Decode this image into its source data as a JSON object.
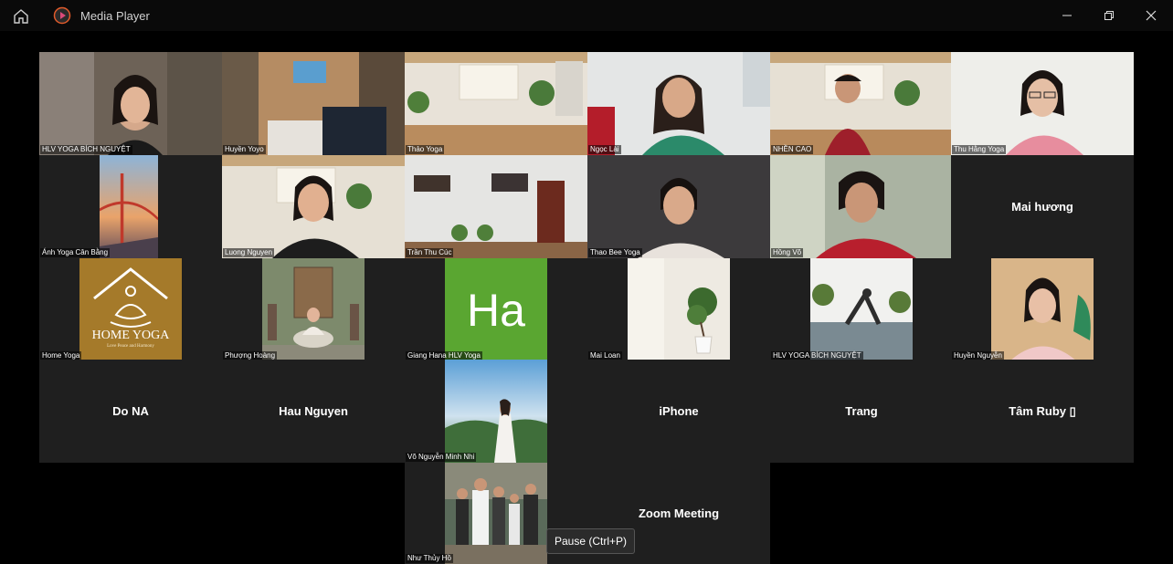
{
  "window": {
    "title": "Media Player"
  },
  "tiles": [
    {
      "name": "HLV YOGA BÍCH NGUYỆT"
    },
    {
      "name": "Huyền Yoyo"
    },
    {
      "name": "Thảo Yoga"
    },
    {
      "name": "Ngọc Lài"
    },
    {
      "name": "NHỀN CAO"
    },
    {
      "name": "Thu Hằng Yoga"
    },
    {
      "name": "Ánh Yoga Cân Bằng"
    },
    {
      "name": "Luong Nguyen"
    },
    {
      "name": "Trần Thu Cúc"
    },
    {
      "name": "Thao Bee Yoga"
    },
    {
      "name": "Hồng Võ"
    },
    {
      "name": "Mai hương"
    },
    {
      "name": "Home Yoga",
      "logo_title": "HOME YOGA",
      "logo_sub": "Love Peace and Harmony"
    },
    {
      "name": "Phượng Hoàng"
    },
    {
      "name": "Giang Hana HLV Yoga",
      "initials": "Ha"
    },
    {
      "name": "Mai Loan"
    },
    {
      "name": "HLV YOGA BÍCH NGUYỆT"
    },
    {
      "name": "Huyền Nguyễn"
    },
    {
      "name": "Do NA"
    },
    {
      "name": "Hau Nguyen"
    },
    {
      "name": "Võ Nguyễn Minh Nhi"
    },
    {
      "name": "iPhone"
    },
    {
      "name": "Trang"
    },
    {
      "name": "Tâm Ruby ▯"
    },
    {
      "name": "Như Thủy Hồ"
    },
    {
      "name": "Zoom Meeting"
    }
  ],
  "tooltip": {
    "text": "Pause (Ctrl+P)"
  },
  "colors": {
    "tile_background": "#1f1f1f",
    "initials_background": "#5aa631",
    "logo_background": "#a57a2a"
  }
}
